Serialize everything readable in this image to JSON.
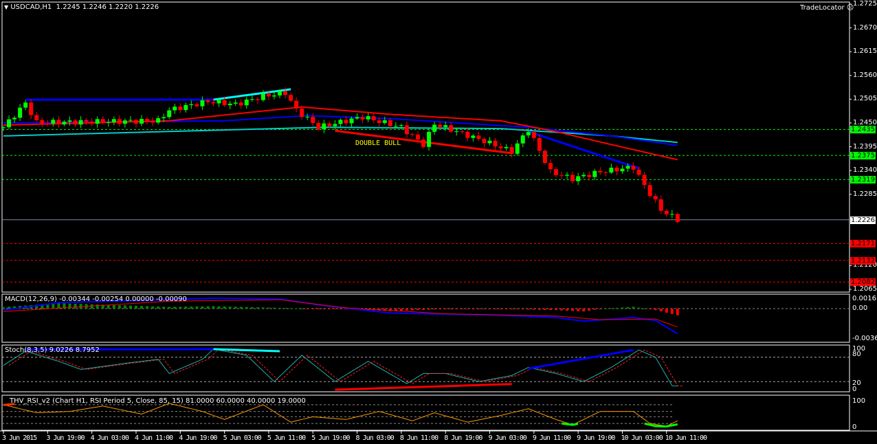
{
  "header": {
    "symbol": "USDCAD,H1",
    "ohlc": "1.2245 1.2246 1.2220 1.2226",
    "tradelocator": "TradeLocator",
    "double_bull": "DOUBLE BULL"
  },
  "colors": {
    "bull": "#00ff00",
    "bear": "#ff0000",
    "ma_red": "#ff0000",
    "ma_blue": "#0000ff",
    "ma_cyan": "#00cccc",
    "level_green": "#00ff00",
    "level_red": "#ff0000"
  },
  "price_axis": [
    "1.2725",
    "1.2670",
    "1.2615",
    "1.2560",
    "1.2505",
    "1.2450",
    "1.2395",
    "1.2340",
    "1.2285",
    "1.2120",
    "1.2065"
  ],
  "levels": [
    {
      "value": "1.2435",
      "type": "green"
    },
    {
      "value": "1.2375",
      "type": "green"
    },
    {
      "value": "1.2319",
      "type": "green"
    },
    {
      "value": "1.2226",
      "type": "current"
    },
    {
      "value": "1.2171",
      "type": "red"
    },
    {
      "value": "1.2132",
      "type": "red"
    },
    {
      "value": "1.2082",
      "type": "red"
    }
  ],
  "time_axis": [
    "3 Jun 2015",
    "3 Jun 19:00",
    "4 Jun 03:00",
    "4 Jun 11:00",
    "4 Jun 19:00",
    "5 Jun 03:00",
    "5 Jun 11:00",
    "5 Jun 19:00",
    "8 Jun 03:00",
    "8 Jun 11:00",
    "8 Jun 19:00",
    "9 Jun 03:00",
    "9 Jun 11:00",
    "9 Jun 19:00",
    "10 Jun 03:00",
    "10 Jun 11:00"
  ],
  "macd": {
    "label": "MACD(12,26,9) -0.00344 -0.00254 0.00000 -0.00090",
    "axis": [
      "0.00161",
      "0.00",
      "-0.00368"
    ]
  },
  "stoch": {
    "label": "Stoch(8,3,5) 9.0226 8.7952",
    "axis": [
      "100",
      "80",
      "20",
      "0"
    ]
  },
  "rsi": {
    "label": "THV_RSI_v2  (Chart H1,  RSI Period 5,  Close,  85,  15)  81.0000 60.0000 40.0000 19.0000",
    "axis": [
      "100",
      "0"
    ]
  },
  "chart_data": {
    "type": "candlestick",
    "price_range": [
      1.2065,
      1.2725
    ],
    "price_waypoints": [
      [
        0,
        1.244
      ],
      [
        4,
        1.2496
      ],
      [
        6,
        1.2451
      ],
      [
        28,
        1.2455
      ],
      [
        30,
        1.248
      ],
      [
        37,
        1.25
      ],
      [
        42,
        1.2493
      ],
      [
        47,
        1.2512
      ],
      [
        51,
        1.252
      ],
      [
        53,
        1.248
      ],
      [
        57,
        1.244
      ],
      [
        65,
        1.2464
      ],
      [
        72,
        1.244
      ],
      [
        76,
        1.24
      ],
      [
        78,
        1.2448
      ],
      [
        87,
        1.2408
      ],
      [
        92,
        1.2384
      ],
      [
        95,
        1.2435
      ],
      [
        99,
        1.2337
      ],
      [
        103,
        1.2321
      ],
      [
        108,
        1.2337
      ],
      [
        114,
        1.2348
      ],
      [
        116,
        1.2305
      ],
      [
        119,
        1.2249
      ],
      [
        122,
        1.2226
      ]
    ],
    "ma_red": [
      [
        0,
        1.2445
      ],
      [
        30,
        1.2455
      ],
      [
        54,
        1.2487
      ],
      [
        70,
        1.247
      ],
      [
        90,
        1.2455
      ],
      [
        100,
        1.243
      ],
      [
        110,
        1.24
      ],
      [
        122,
        1.2365
      ]
    ],
    "ma_blue": [
      [
        0,
        1.245
      ],
      [
        40,
        1.2455
      ],
      [
        55,
        1.2467
      ],
      [
        70,
        1.246
      ],
      [
        95,
        1.244
      ],
      [
        110,
        1.242
      ],
      [
        122,
        1.2398
      ]
    ],
    "ma_cyan": [
      [
        0,
        1.242
      ],
      [
        58,
        1.244
      ],
      [
        90,
        1.2437
      ],
      [
        110,
        1.242
      ],
      [
        122,
        1.2405
      ]
    ],
    "trendlines": [
      {
        "color": "#0000ff",
        "points": [
          [
            4,
            1.2504
          ],
          [
            38,
            1.2504
          ]
        ]
      },
      {
        "color": "#00ffff",
        "points": [
          [
            38,
            1.2504
          ],
          [
            52,
            1.2528
          ]
        ]
      },
      {
        "color": "#ff0000",
        "points": [
          [
            60,
            1.2432
          ],
          [
            92,
            1.238
          ]
        ]
      },
      {
        "color": "#0000ff",
        "points": [
          [
            95,
            1.243
          ],
          [
            115,
            1.2345
          ]
        ]
      }
    ],
    "macd_main": [
      [
        0,
        -0.0002
      ],
      [
        10,
        0.0008
      ],
      [
        38,
        0.0014
      ],
      [
        50,
        0.0013
      ],
      [
        58,
        0.0004
      ],
      [
        70,
        -0.0006
      ],
      [
        90,
        -0.0009
      ],
      [
        100,
        -0.0012
      ],
      [
        105,
        -0.0017
      ],
      [
        114,
        -0.0012
      ],
      [
        118,
        -0.0016
      ],
      [
        122,
        -0.0034
      ]
    ],
    "macd_signal": [
      [
        0,
        -0.0004
      ],
      [
        30,
        0.001
      ],
      [
        50,
        0.0012
      ],
      [
        62,
        0.0001
      ],
      [
        80,
        -0.0007
      ],
      [
        100,
        -0.001
      ],
      [
        108,
        -0.0015
      ],
      [
        118,
        -0.0014
      ],
      [
        122,
        -0.0025
      ]
    ],
    "stoch_main": [
      [
        0,
        60
      ],
      [
        4,
        95
      ],
      [
        10,
        70
      ],
      [
        14,
        50
      ],
      [
        22,
        65
      ],
      [
        28,
        75
      ],
      [
        30,
        40
      ],
      [
        36,
        75
      ],
      [
        38,
        100
      ],
      [
        44,
        85
      ],
      [
        49,
        20
      ],
      [
        54,
        85
      ],
      [
        60,
        20
      ],
      [
        66,
        70
      ],
      [
        73,
        15
      ],
      [
        76,
        40
      ],
      [
        80,
        40
      ],
      [
        86,
        20
      ],
      [
        92,
        35
      ],
      [
        95,
        55
      ],
      [
        100,
        40
      ],
      [
        105,
        20
      ],
      [
        110,
        55
      ],
      [
        115,
        98
      ],
      [
        118,
        80
      ],
      [
        121,
        10
      ],
      [
        122,
        9
      ]
    ],
    "rsi_main": [
      [
        0,
        85
      ],
      [
        6,
        55
      ],
      [
        12,
        60
      ],
      [
        18,
        80
      ],
      [
        25,
        50
      ],
      [
        30,
        90
      ],
      [
        36,
        60
      ],
      [
        40,
        30
      ],
      [
        47,
        85
      ],
      [
        52,
        20
      ],
      [
        56,
        40
      ],
      [
        62,
        30
      ],
      [
        68,
        60
      ],
      [
        74,
        25
      ],
      [
        78,
        55
      ],
      [
        84,
        20
      ],
      [
        90,
        45
      ],
      [
        95,
        70
      ],
      [
        100,
        30
      ],
      [
        103,
        10
      ],
      [
        108,
        60
      ],
      [
        114,
        60
      ],
      [
        117,
        15
      ],
      [
        120,
        5
      ],
      [
        122,
        25
      ]
    ]
  }
}
